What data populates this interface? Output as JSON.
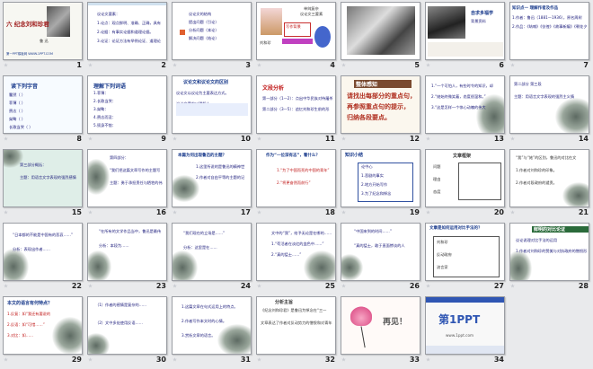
{
  "slides": [
    {
      "num": "1",
      "title": "六 纪念刘和珍君",
      "sub": "鲁 迅",
      "foot": "第一PPT模板网 WWW.1PPT.COM"
    },
    {
      "num": "2",
      "lines": [
        "议论文要素：",
        "1.论点：观点鲜明、准确、正确，具有针对性。",
        "2.论据：有事实论据和道理论据。",
        "3.论证：论证方法有举例论证、道理论证、对比论证、比喻论证等。"
      ]
    },
    {
      "num": "3",
      "lines": [
        "议论文的结构",
        "提出问题（引论）",
        "分析问题（本论）",
        "解决问题（结论）"
      ]
    },
    {
      "num": "4",
      "title": "刘和珍",
      "cap": "单纯复杂",
      "cap2": "议论文三要素",
      "box": "写作背景"
    },
    {
      "num": "5",
      "cap": ""
    },
    {
      "num": "6",
      "title": "自求多福学",
      "lines": [
        "背景资料"
      ]
    },
    {
      "num": "7",
      "title": "知识点一 理解作者及作品",
      "lines": [
        "1.作者：鲁迅（1881—1936），原名周树人。",
        "2.作品：《呐喊》《彷徨》《故事新编》《朝花夕拾》《野草》等。"
      ]
    },
    {
      "num": "8",
      "title": "读下列字音",
      "lines": [
        "瞿然（ ）",
        "菲薄（ ）",
        "赍志（ ）",
        "桀骜（ ）",
        "长歌当哭（ ）"
      ]
    },
    {
      "num": "9",
      "title": "理解下列词语",
      "lines": [
        "1.菲薄：",
        "2.长歌当哭：",
        "3.桀骜：",
        "4.赍志而没：",
        "5.殒身不恤："
      ]
    },
    {
      "num": "10",
      "title": "议论文和议论文的区别",
      "lines": [
        "议论文以议论为主要表达方式。",
        "议论文要求以理服人。"
      ]
    },
    {
      "num": "11",
      "title": "文段分析",
      "lines": [
        "第一部分（1—2）：点出中华民族对待屠杀的态度。",
        "第二部分（3—5）：追忆刘和珍生前的形象。"
      ]
    },
    {
      "num": "12",
      "title": "整体感知",
      "lines": [
        "请找出每部分的重点句，",
        "再参照重点句的提示，",
        "归纳各段要点。"
      ]
    },
    {
      "num": "13",
      "lines": [
        "1.“一个可怕人，有些时令的知识，却不能知道自己将要做什么……”",
        "2.“她始终微笑着，态度很温和。”",
        "3.“这是怎样一个惊心动魄的伟大呵！”"
      ]
    },
    {
      "num": "14",
      "lines": [
        "第二部分 第三段",
        "主题：用语言文字表现的强烈主义情感"
      ]
    },
    {
      "num": "15",
      "lines": [
        "第三部分概括：",
        "主题：用语言文字表现的强烈感情的独立文章"
      ]
    },
    {
      "num": "16",
      "lines": [
        "第四部分：",
        "\"我们把这篇文章写作的主题写为……\"",
        "主题：勇于承担责任与牺牲的伟大"
      ]
    },
    {
      "num": "17",
      "title": "本篇为何出现鲁迅的主题？",
      "lines": [
        "1.这里所说的是鲁迅的精神世界的主题。",
        "2.作者对自由平等的主题的记忆，表现出作者的真实情感。"
      ]
    },
    {
      "num": "18",
      "title": "作为“一位深有志”，看什么？",
      "lines": [
        "1.“为了中国而死的中国的青年”",
        "2.“将更奋然而前行”"
      ]
    },
    {
      "num": "19",
      "title": "知识小结",
      "lines": [
        "论中心",
        "1.悲剧的事实",
        "2.地方开始写作",
        "3.为了纪念和悼念"
      ]
    },
    {
      "num": "20",
      "title": "文章框架",
      "lines": [
        "问题",
        "理由",
        "态度"
      ]
    },
    {
      "num": "21",
      "lines": [
        "“我”与“她”的区别，鲁迅的对比在文中……",
        "1.作者对刘和珍的印象。",
        "2.作者对段政府的谴责。"
      ]
    },
    {
      "num": "22",
      "lines": [
        "“日本都的不能是中国有的悲哀……”",
        "分析：表现出作者……"
      ]
    },
    {
      "num": "23",
      "lines": [
        "“在所有的文学作品当中，鲁迅是最伟大的……”",
        "分析：本段为……"
      ]
    },
    {
      "num": "24",
      "lines": [
        "“我们现在的立场是……”",
        "分析：这里是在……"
      ]
    },
    {
      "num": "25",
      "lines": [
        "文中的“我”，给予无论是在哪的……",
        "1.“苟活者在淡红的血色中……”",
        "2.“真的猛士……”"
      ]
    },
    {
      "num": "26",
      "lines": [
        "“中国来到的时间……”",
        "“真的猛士，敢于直面惨淡的人生……”"
      ]
    },
    {
      "num": "27",
      "title": "文章是如何运用对比手法的？",
      "lines": [
        "刘和珍",
        "反动政府",
        "流言家"
      ]
    },
    {
      "num": "28",
      "title": "鲜明的对比论证",
      "lines": [
        "议论说理对比手法的运用",
        "1.作者对刘和珍的赞美与对执政府的憎恨形成对比。"
      ]
    },
    {
      "num": "29",
      "title": "本文的语言有何特点？",
      "lines": [
        "1.反复：如“我还有要说的话……”",
        "2.反语：如“可惜……”",
        "3.对比：如……"
      ]
    },
    {
      "num": "30",
      "lines": [
        "（1）作者的感情是复杂的……",
        "（2）文中多处使用反语……"
      ]
    },
    {
      "num": "31",
      "lines": [
        "1.这篇文章在句式运用上的特点。",
        "2.作者写作本文时的心情。",
        "3.赏析文章的语言。"
      ]
    },
    {
      "num": "32",
      "title": "分析主旨",
      "lines": [
        "《纪念刘和珍君》是鲁迅为悼念在“三一八”惨案中牺牲的刘和珍而写的一篇散文。",
        "文章表达了作者对反动势力的憎恨和对青年的赞颂。"
      ]
    },
    {
      "num": "33",
      "title": "再见！"
    },
    {
      "num": "34",
      "title": "第1PPT",
      "sub": "www.1ppt.com"
    }
  ],
  "colors": {
    "blue": "#1a3b8c",
    "red": "#c01818",
    "bg": "#e9eaec"
  }
}
